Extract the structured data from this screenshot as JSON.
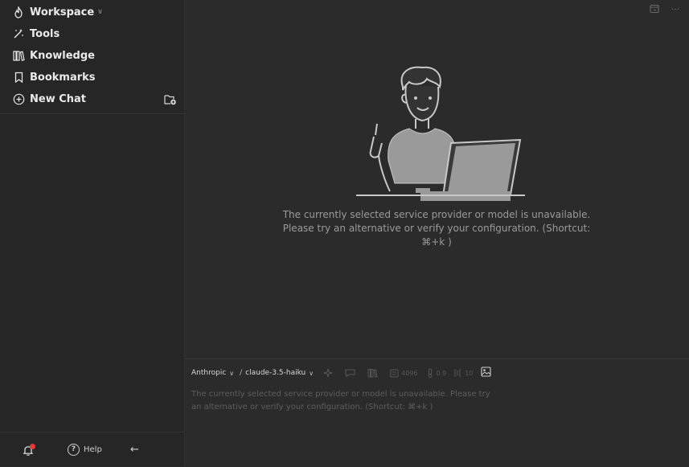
{
  "sidebar": {
    "items": [
      {
        "label": "Workspace",
        "icon": "flame-icon"
      },
      {
        "label": "Tools",
        "icon": "magic-wand-icon"
      },
      {
        "label": "Knowledge",
        "icon": "books-icon"
      },
      {
        "label": "Bookmarks",
        "icon": "bookmark-icon"
      },
      {
        "label": "New Chat",
        "icon": "plus-circle-icon"
      }
    ],
    "footer": {
      "help_label": "Help",
      "back_glyph": "←"
    }
  },
  "main": {
    "message": "The currently selected service provider or model is unavailable. Please try an alternative or verify your configuration. (Shortcut: ⌘+k )",
    "top_more_glyph": "···"
  },
  "composer": {
    "provider": "Anthropic",
    "model": "claude-3.5-haiku",
    "max_tokens": "4096",
    "temperature": "0.9",
    "context_count": "10",
    "placeholder": "The currently selected service provider or model is unavailable. Please try an alternative or verify your configuration. (Shortcut: ⌘+k )"
  },
  "colors": {
    "sidebar_bg": "#262626",
    "main_bg": "#2b2b2b",
    "badge": "#e5383b"
  }
}
